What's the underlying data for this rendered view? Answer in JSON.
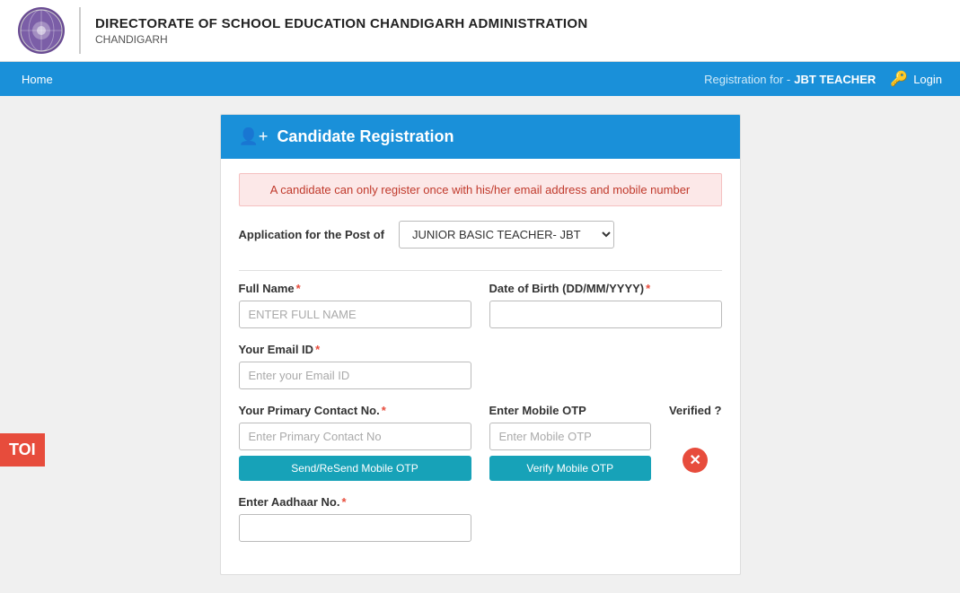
{
  "header": {
    "logo_alt": "Chandigarh Education Logo",
    "title": "DIRECTORATE OF SCHOOL EDUCATION CHANDIGARH ADMINISTRATION",
    "subtitle": "CHANDIGARH"
  },
  "navbar": {
    "home_label": "Home",
    "registration_prefix": "Registration for -",
    "registration_value": "JBT TEACHER",
    "login_label": "Login",
    "login_icon": "🔑"
  },
  "form": {
    "header_icon": "👤",
    "header_title": "Candidate Registration",
    "alert_message": "A candidate can only register once with his/her email address and mobile number",
    "application_label": "Application for the Post of",
    "application_options": [
      "JUNIOR BASIC TEACHER- JBT"
    ],
    "application_selected": "JUNIOR BASIC TEACHER- JBT",
    "full_name_label": "Full Name",
    "full_name_placeholder": "ENTER FULL NAME",
    "dob_label": "Date of Birth (DD/MM/YYYY)",
    "dob_placeholder": "",
    "email_label": "Your Email ID",
    "email_placeholder": "Enter your Email ID",
    "primary_contact_label": "Your Primary Contact No.",
    "primary_contact_placeholder": "Enter Primary Contact No",
    "send_otp_label": "Send/ReSend Mobile OTP",
    "enter_mobile_otp_label": "Enter Mobile OTP",
    "enter_mobile_otp_placeholder": "Enter Mobile OTP",
    "verify_otp_label": "Verify Mobile OTP",
    "verified_label": "Verified ?",
    "verified_icon": "✕",
    "aadhaar_label": "Enter Aadhaar No.",
    "required_symbol": "*",
    "toi_badge": "TOI"
  }
}
